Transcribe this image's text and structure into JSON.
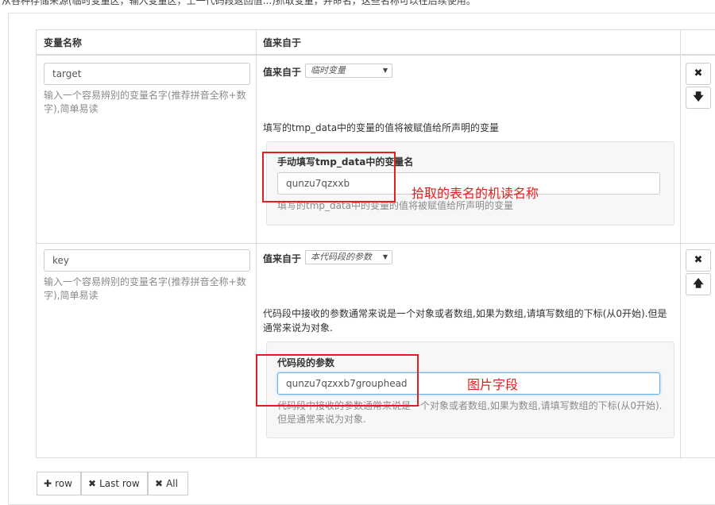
{
  "intro_text": "从各种存储来源(临时变量区，输入变量区，上一代码段返回值...)抓取变量，并命名，这些名称可以在后续使用。",
  "table": {
    "col_name": "变量名称",
    "col_source": "值来自于"
  },
  "rows": [
    {
      "name_value": "target",
      "name_help": "输入一个容易辨别的变量名字(推荐拼音全称+数字),简单易读",
      "source_label": "值来自于",
      "source_select": "临时变量",
      "source_desc": "填写的tmp_data中的变量的值将被赋值给所声明的变量",
      "field_label": "手动填写tmp_data中的变量名",
      "field_value": "qunzu7qzxxb",
      "field_help": "填写的tmp_data中的变量的值将被赋值给所声明的变量",
      "annotation": "拾取的表名的机读名称"
    },
    {
      "name_value": "key",
      "name_help": "输入一个容易辨别的变量名字(推荐拼音全称+数字),简单易读",
      "source_label": "值来自于",
      "source_select": "本代码段的参数",
      "source_desc": "代码段中接收的参数通常来说是一个对象或者数组,如果为数组,请填写数组的下标(从0开始).但是通常来说为对象.",
      "field_label": "代码段的参数",
      "field_value": "qunzu7qzxxb7grouphead",
      "field_help": "代码段中接收的参数通常来说是一个对象或者数组,如果为数组,请填写数组的下标(从0开始).但是通常来说为对象.",
      "annotation": "图片字段"
    }
  ],
  "icons": {
    "remove": "✖",
    "down": "🡇",
    "up": "🡅",
    "plus": "✚"
  },
  "buttons": {
    "row": "row",
    "last_row": "Last row",
    "all": "All"
  },
  "colors": {
    "annotation_red": "#e21f1f",
    "focus_blue": "#66afe9"
  }
}
